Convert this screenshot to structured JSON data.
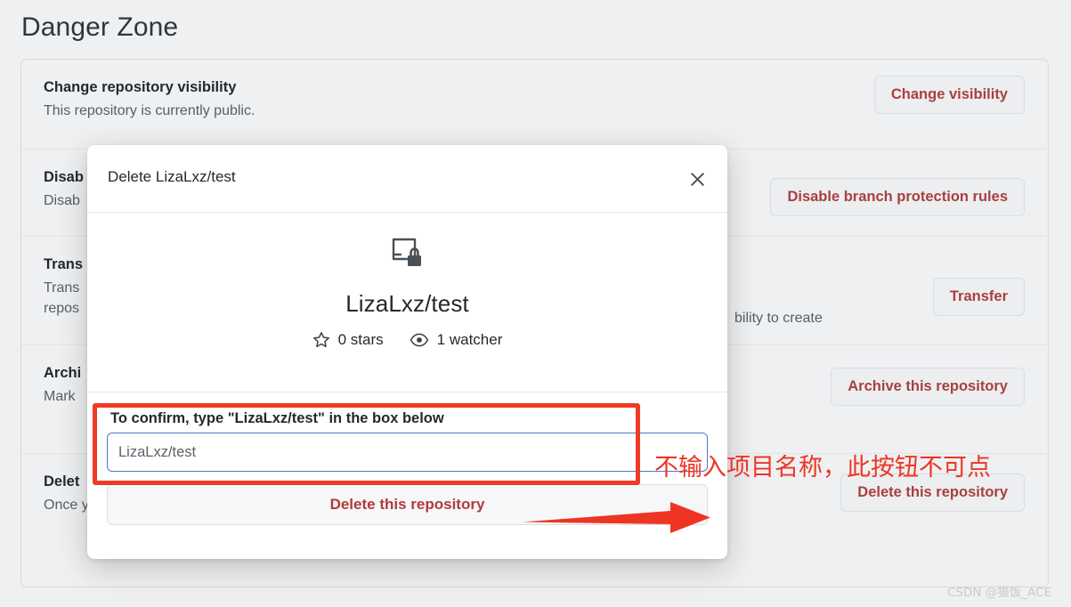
{
  "page": {
    "title": "Danger Zone",
    "watermark": "CSDN @猫饭_ACE",
    "accent_red": "#a9403f",
    "annotation_red": "#ee3524",
    "panel_border": "#f0cfce"
  },
  "danger_zone": {
    "rows": [
      {
        "title": "Change repository visibility",
        "desc": "This repository is currently public.",
        "button": "Change visibility"
      },
      {
        "title": "Disab",
        "desc": "Disab",
        "button": "Disable branch protection rules"
      },
      {
        "title": "Trans",
        "desc": "Trans",
        "desc2": "repos",
        "desc_right": "bility to create",
        "button": "Transfer"
      },
      {
        "title": "Archi",
        "desc": "Mark",
        "button": "Archive this repository"
      },
      {
        "title": "Delet",
        "desc": "Once y",
        "button": "Delete this repository"
      }
    ]
  },
  "modal": {
    "title": "Delete LizaLxz/test",
    "close_label": "×",
    "repo_icon": "repo-locked-icon",
    "repo_full_name": "LizaLxz/test",
    "stars": "0 stars",
    "watchers": "1 watcher",
    "confirm_label": "To confirm, type \"LizaLxz/test\" in the box below",
    "confirm_input_value": "",
    "confirm_input_placeholder": "LizaLxz/test",
    "delete_button": "Delete this repository"
  },
  "annotations": {
    "note": "不输入项目名称，此按钮不可点"
  }
}
